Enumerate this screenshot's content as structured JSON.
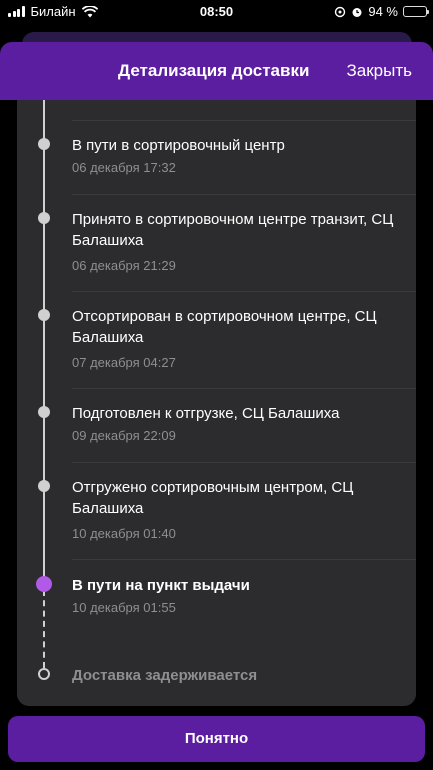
{
  "status_bar": {
    "carrier": "Билайн",
    "time": "08:50",
    "battery": "94 %",
    "battery_level": 0.94
  },
  "header": {
    "title": "Детализация доставки",
    "close_label": "Закрыть"
  },
  "timeline": [
    {
      "title": "В пути в сортировочный центр",
      "date": "06 декабря 17:32"
    },
    {
      "title": "Принято в сортировочном центре транзит, СЦ Балашиха",
      "date": "06 декабря 21:29"
    },
    {
      "title": "Отсортирован в сортировочном центре, СЦ Балашиха",
      "date": "07 декабря 04:27"
    },
    {
      "title": "Подготовлен к отгрузке, СЦ Балашиха",
      "date": "09 декабря 22:09"
    },
    {
      "title": "Отгружено сортировочным центром, СЦ Балашиха",
      "date": "10 декабря 01:40"
    },
    {
      "title": "В пути на пункт выдачи",
      "date": "10 декабря 01:55"
    },
    {
      "title": "Доставка задерживается"
    }
  ],
  "confirm_button": "Понятно",
  "colors": {
    "accent": "#5c1ea0",
    "active_dot": "#b25ae8",
    "card": "#2c2c2e"
  }
}
